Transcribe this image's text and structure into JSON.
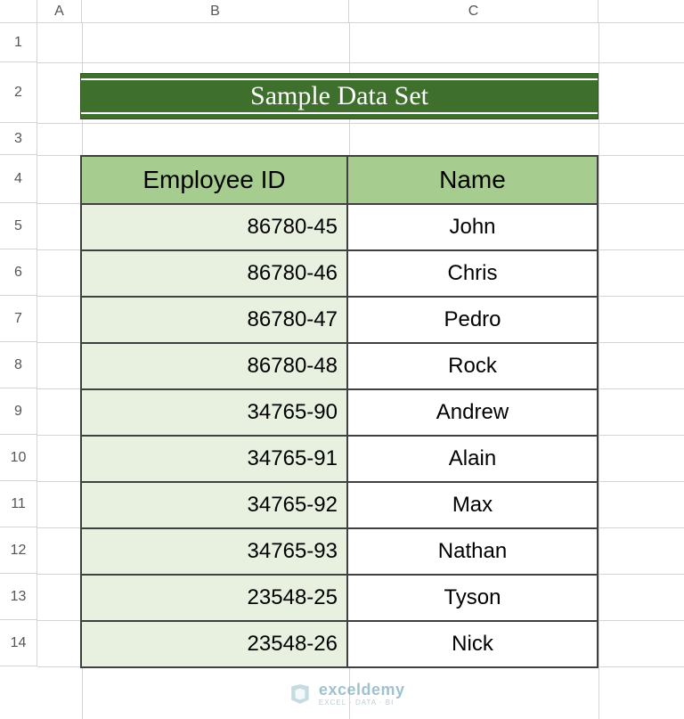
{
  "columns": {
    "A": "A",
    "B": "B",
    "C": "C"
  },
  "rows": [
    "1",
    "2",
    "3",
    "4",
    "5",
    "6",
    "7",
    "8",
    "9",
    "10",
    "11",
    "12",
    "13",
    "14"
  ],
  "title": "Sample Data Set",
  "table": {
    "headers": {
      "id": "Employee ID",
      "name": "Name"
    },
    "data": [
      {
        "id": "86780-45",
        "name": "John"
      },
      {
        "id": "86780-46",
        "name": "Chris"
      },
      {
        "id": "86780-47",
        "name": "Pedro"
      },
      {
        "id": "86780-48",
        "name": "Rock"
      },
      {
        "id": "34765-90",
        "name": "Andrew"
      },
      {
        "id": "34765-91",
        "name": "Alain"
      },
      {
        "id": "34765-92",
        "name": "Max"
      },
      {
        "id": "34765-93",
        "name": "Nathan"
      },
      {
        "id": "23548-25",
        "name": "Tyson"
      },
      {
        "id": "23548-26",
        "name": "Nick"
      }
    ]
  },
  "watermark": {
    "brand": "exceldemy",
    "tag": "EXCEL · DATA · BI"
  }
}
